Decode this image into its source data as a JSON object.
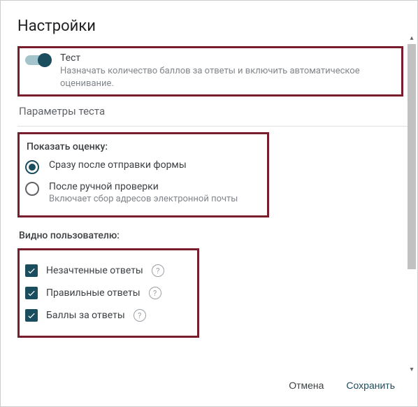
{
  "dialog": {
    "title": "Настройки"
  },
  "quiz_toggle": {
    "label": "Тест",
    "description": "Назначать количество баллов за ответы и включить автоматическое оценивание.",
    "enabled": true
  },
  "quiz_params": {
    "title": "Параметры теста"
  },
  "release_grade": {
    "title": "Показать оценку:",
    "options": [
      {
        "label": "Сразу после отправки формы",
        "selected": true
      },
      {
        "label": "После ручной проверки",
        "description": "Включает сбор адресов электронной почты",
        "selected": false
      }
    ]
  },
  "respondent_view": {
    "title": "Видно пользователю:",
    "items": [
      {
        "label": "Незачтенные ответы",
        "checked": true
      },
      {
        "label": "Правильные ответы",
        "checked": true
      },
      {
        "label": "Баллы за ответы",
        "checked": true
      }
    ]
  },
  "actions": {
    "cancel": "Отмена",
    "save": "Сохранить"
  }
}
